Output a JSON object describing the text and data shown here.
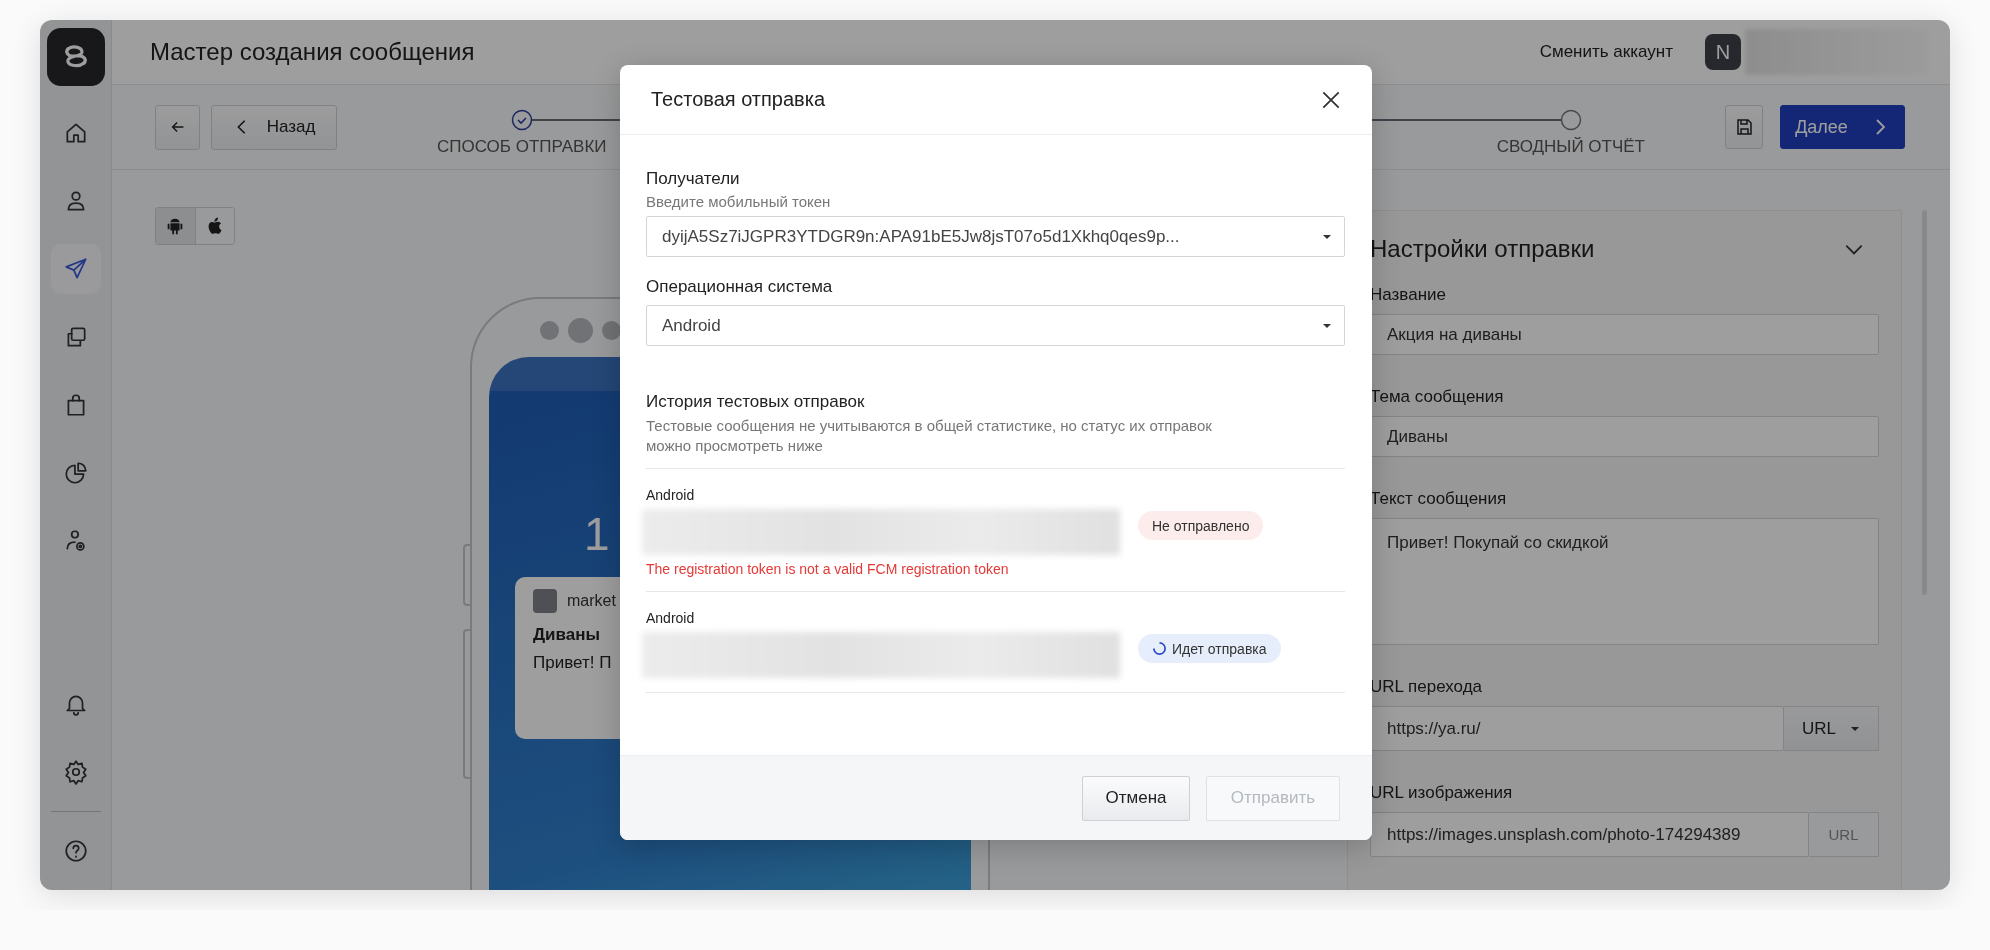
{
  "app": {
    "title": "Мастер создания сообщения",
    "switch_account": "Сменить аккаунт",
    "avatar_initial": "N"
  },
  "sidebar": {
    "items": [
      {
        "kind": "home",
        "selected": false
      },
      {
        "kind": "user",
        "selected": false
      },
      {
        "kind": "send",
        "selected": true
      },
      {
        "kind": "copy",
        "selected": false
      },
      {
        "kind": "bag",
        "selected": false
      },
      {
        "kind": "pie",
        "selected": false
      },
      {
        "kind": "user-gear",
        "selected": false
      },
      {
        "kind": "bell",
        "selected": false
      },
      {
        "kind": "gear",
        "selected": false
      },
      {
        "kind": "help",
        "selected": false
      }
    ]
  },
  "toolbar": {
    "back_label": "Назад",
    "next_label": "Далее"
  },
  "steps": [
    {
      "label": "СПОСОБ ОТПРАВКИ",
      "done": true
    },
    {
      "label": "СВОДНЫЙ ОТЧЁТ",
      "done": false
    }
  ],
  "platform_toggle": [
    {
      "kind": "android",
      "selected": true
    },
    {
      "kind": "apple",
      "selected": false
    }
  ],
  "preview": {
    "clock": "1",
    "app_name": "market",
    "title": "Диваны",
    "body": "Привет! П"
  },
  "settings": {
    "title": "Настройки отправки",
    "fields": [
      {
        "kind": "text",
        "label": "Название",
        "value": "Акция на диваны"
      },
      {
        "kind": "text",
        "label": "Тема сообщения",
        "value": "Диваны"
      },
      {
        "kind": "textarea",
        "label": "Текст сообщения",
        "value": "Привет! Покупай со скидкой"
      },
      {
        "kind": "url-select",
        "label": "URL перехода",
        "value": "https://ya.ru/",
        "addon": "URL"
      },
      {
        "kind": "url-static",
        "label": "URL изображения",
        "value": "https://images.unsplash.com/photo-174294389",
        "addon": "URL"
      }
    ]
  },
  "modal": {
    "title": "Тестовая отправка",
    "recipients": {
      "label": "Получатели",
      "hint": "Введите мобильный токен",
      "value": "dyijA5Sz7iJGPR3YTDGR9n:APA91bE5Jw8jsT07o5d1Xkhq0qes9p..."
    },
    "os": {
      "label": "Операционная система",
      "value": "Android"
    },
    "history": {
      "title": "История тестовых отправок",
      "description": "Тестовые сообщения не учитываются в общей статистике, но статус их отправок можно просмотреть ниже",
      "items": [
        {
          "platform": "Android",
          "status": {
            "kind": "error",
            "label": "Не отправлено"
          },
          "error": "The registration token is not a valid FCM registration token"
        },
        {
          "platform": "Android",
          "status": {
            "kind": "sending",
            "label": "Идет отправка"
          }
        }
      ]
    },
    "buttons": [
      {
        "label": "Отмена",
        "disabled": false
      },
      {
        "label": "Отправить",
        "disabled": true
      }
    ]
  }
}
